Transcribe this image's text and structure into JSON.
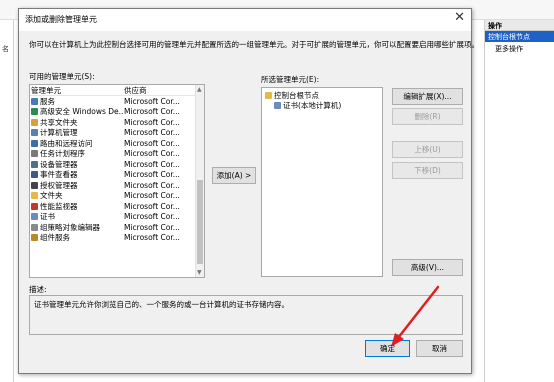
{
  "background": {
    "left_label": "名",
    "actions": {
      "header": "操作",
      "selected_item": "控制台根节点",
      "more": "更多操作"
    }
  },
  "dialog": {
    "title": "添加或删除管理单元",
    "close_glyph": "✕",
    "description": "你可以在计算机上为此控制台选择可用的管理单元并配置所选的一组管理单元。对于可扩展的管理单元，你可以配置要启用哪些扩展项。",
    "available_label": "可用的管理单元(S):",
    "available_columns": [
      "管理单元",
      "供应商"
    ],
    "available_items": [
      {
        "name": "服务",
        "vendor": "Microsoft Cor...",
        "icon": "services-icon",
        "color": "#4a7ab8"
      },
      {
        "name": "高级安全 Windows De...",
        "vendor": "Microsoft Cor...",
        "icon": "firewall-icon",
        "color": "#2e8b57"
      },
      {
        "name": "共享文件夹",
        "vendor": "Microsoft Cor...",
        "icon": "shared-folder-icon",
        "color": "#d8a23a"
      },
      {
        "name": "计算机管理",
        "vendor": "Microsoft Cor...",
        "icon": "computer-management-icon",
        "color": "#5a7fb0"
      },
      {
        "name": "路由和远程访问",
        "vendor": "Microsoft Cor...",
        "icon": "routing-icon",
        "color": "#3a6ea5"
      },
      {
        "name": "任务计划程序",
        "vendor": "Microsoft Cor...",
        "icon": "task-scheduler-icon",
        "color": "#7a7a7a"
      },
      {
        "name": "设备管理器",
        "vendor": "Microsoft Cor...",
        "icon": "device-manager-icon",
        "color": "#4f6f8f"
      },
      {
        "name": "事件查看器",
        "vendor": "Microsoft Cor...",
        "icon": "event-viewer-icon",
        "color": "#3c5a8a"
      },
      {
        "name": "授权管理器",
        "vendor": "Microsoft Cor...",
        "icon": "authorization-manager-icon",
        "color": "#444444"
      },
      {
        "name": "文件夹",
        "vendor": "Microsoft Cor...",
        "icon": "folder-icon",
        "color": "#e6b84a"
      },
      {
        "name": "性能监视器",
        "vendor": "Microsoft Cor...",
        "icon": "performance-monitor-icon",
        "color": "#c0392b"
      },
      {
        "name": "证书",
        "vendor": "Microsoft Cor...",
        "icon": "certificate-icon",
        "color": "#6a8cc0"
      },
      {
        "name": "组策略对象编辑器",
        "vendor": "Microsoft Cor...",
        "icon": "group-policy-icon",
        "color": "#8a8a8a"
      },
      {
        "name": "组件服务",
        "vendor": "Microsoft Cor...",
        "icon": "component-services-icon",
        "color": "#b58a2a"
      }
    ],
    "add_button": "添加(A) >",
    "selected_label": "所选管理单元(E):",
    "selected_tree": [
      {
        "name": "控制台根节点",
        "icon": "folder-icon",
        "color": "#e6b84a",
        "level": 0
      },
      {
        "name": "证书(本地计算机)",
        "icon": "certificate-icon",
        "color": "#6a8cc0",
        "level": 1
      }
    ],
    "buttons": {
      "edit_extensions": "编辑扩展(X)...",
      "remove": "删除(R)",
      "move_up": "上移(U)",
      "move_down": "下移(D)",
      "advanced": "高级(V)...",
      "ok": "确定",
      "cancel": "取消"
    },
    "desc_label": "描述:",
    "desc_text": "证书管理单元允许你浏览自己的、一个服务的或一台计算机的证书存储内容。"
  },
  "annotation_color": "#e02020"
}
